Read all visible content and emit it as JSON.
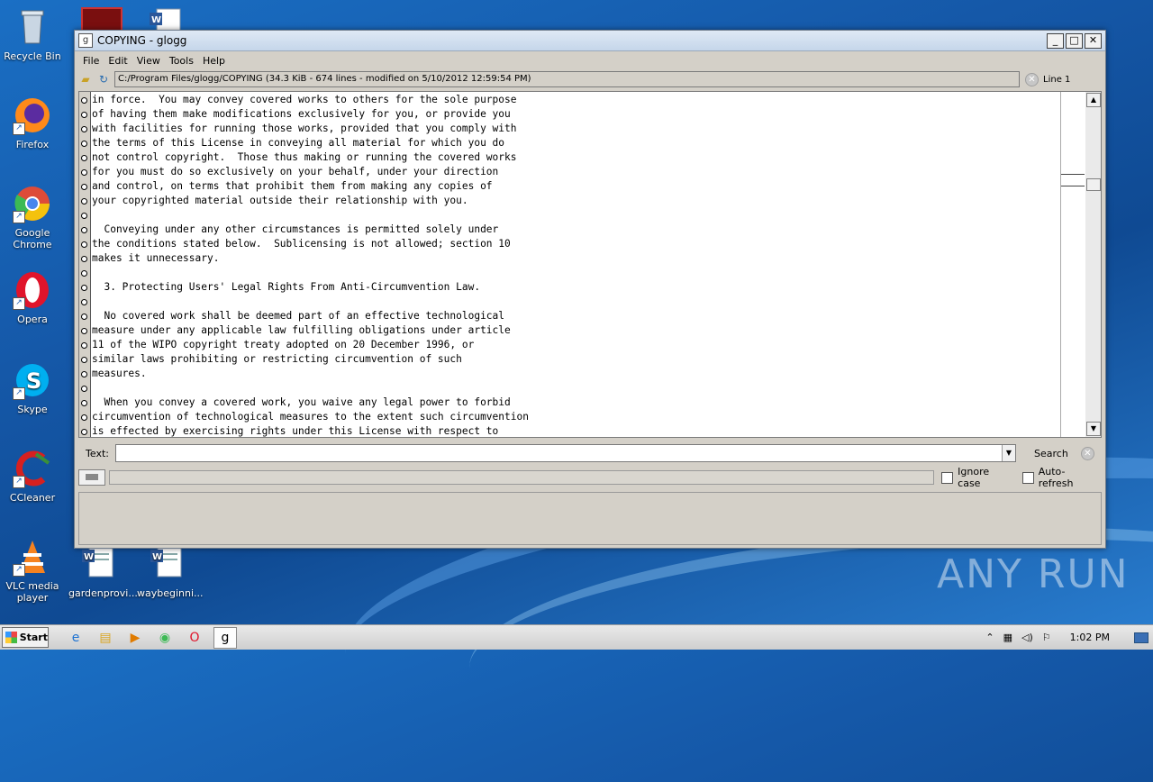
{
  "desktop": {
    "icons": [
      {
        "label": "Recycle Bin"
      },
      {
        "label": "Firefox"
      },
      {
        "label": "Google Chrome"
      },
      {
        "label": "Opera"
      },
      {
        "label": "Skype"
      },
      {
        "label": "CCleaner"
      },
      {
        "label": "VLC media player"
      },
      {
        "label": "gardenprovi..."
      },
      {
        "label": "waybeginni..."
      }
    ],
    "watermark": "ANY RUN"
  },
  "window": {
    "title": "COPYING - glogg",
    "menu": [
      "File",
      "Edit",
      "View",
      "Tools",
      "Help"
    ],
    "path": "C:/Program Files/glogg/COPYING (34.3 KiB - 674 lines - modified on 5/10/2012 12:59:54 PM)",
    "line_indicator": "Line 1",
    "text_lines": [
      "in force.  You may convey covered works to others for the sole purpose",
      "of having them make modifications exclusively for you, or provide you",
      "with facilities for running those works, provided that you comply with",
      "the terms of this License in conveying all material for which you do",
      "not control copyright.  Those thus making or running the covered works",
      "for you must do so exclusively on your behalf, under your direction",
      "and control, on terms that prohibit them from making any copies of",
      "your copyrighted material outside their relationship with you.",
      "",
      "  Conveying under any other circumstances is permitted solely under",
      "the conditions stated below.  Sublicensing is not allowed; section 10",
      "makes it unnecessary.",
      "",
      "  3. Protecting Users' Legal Rights From Anti-Circumvention Law.",
      "",
      "  No covered work shall be deemed part of an effective technological",
      "measure under any applicable law fulfilling obligations under article",
      "11 of the WIPO copyright treaty adopted on 20 December 1996, or",
      "similar laws prohibiting or restricting circumvention of such",
      "measures.",
      "",
      "  When you convey a covered work, you waive any legal power to forbid",
      "circumvention of technological measures to the extent such circumvention",
      "is effected by exercising rights under this License with respect to"
    ],
    "search": {
      "label": "Text:",
      "value": "",
      "button": "Search"
    },
    "options": {
      "ignore_case": "Ignore case",
      "auto_refresh": "Auto-refresh"
    }
  },
  "taskbar": {
    "start": "Start",
    "clock": "1:02 PM"
  }
}
